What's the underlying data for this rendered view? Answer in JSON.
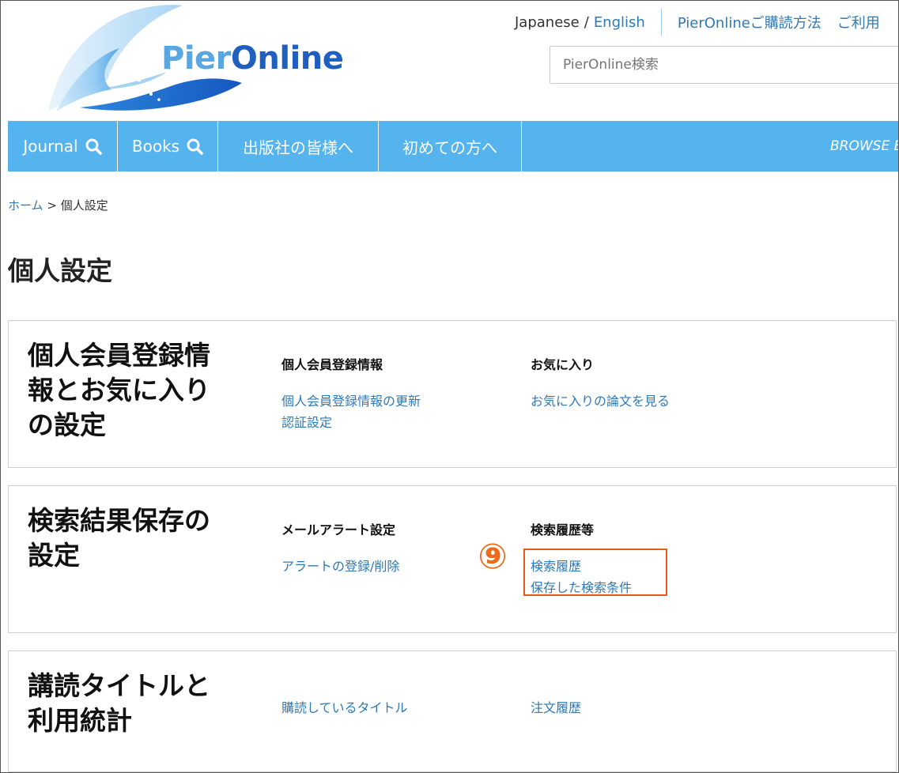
{
  "header": {
    "logo": {
      "part1": "Pier",
      "part2": "Online"
    },
    "lang_japanese": "Japanese",
    "lang_separator": "/",
    "lang_english": "English",
    "subscribe_link": "PierOnlineご購読方法",
    "usage_link": "ご利用",
    "search_placeholder": "PierOnline検索"
  },
  "nav": {
    "journal": "Journal",
    "books": "Books",
    "publishers": "出版社の皆様へ",
    "first_time": "初めての方へ",
    "browse": "BROWSE B"
  },
  "breadcrumb": {
    "home": "ホーム",
    "separator": ">",
    "current": "個人設定"
  },
  "page_title": "個人設定",
  "sections": [
    {
      "title": "個人会員登録情報とお気に入りの設定",
      "col1": {
        "heading": "個人会員登録情報",
        "links": [
          "個人会員登録情報の更新",
          "認証設定"
        ]
      },
      "col2": {
        "heading": "お気に入り",
        "links": [
          "お気に入りの論文を見る"
        ]
      }
    },
    {
      "title": "検索結果保存の設定",
      "col1": {
        "heading": "メールアラート設定",
        "links": [
          "アラートの登録/削除"
        ]
      },
      "col2": {
        "heading": "検索履歴等",
        "links": [
          "検索履歴",
          "保存した検索条件"
        ]
      }
    },
    {
      "title": "講読タイトルと利用統計",
      "col1": {
        "links": [
          "購読しているタイトル"
        ]
      },
      "col2": {
        "links": [
          "注文履歴"
        ]
      }
    }
  ],
  "annotation": {
    "number": "⑨",
    "color": "#e85a16"
  },
  "colors": {
    "nav_bg": "#55b3ee",
    "link": "#2f79b6",
    "logo_light": "#5aa6e0",
    "logo_dark": "#1e5fc0"
  }
}
